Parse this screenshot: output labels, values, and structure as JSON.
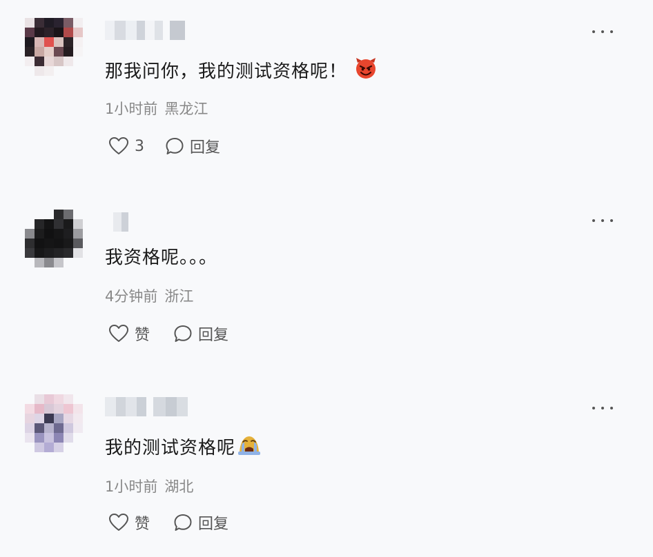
{
  "comments": [
    {
      "content": "那我问你，我的测试资格呢！",
      "emoji": "smiling-devil-emoji",
      "time": "1小时前",
      "location": "黑龙江",
      "like_label": "3",
      "reply_label": "回复"
    },
    {
      "content": "我资格呢。。。",
      "emoji": "",
      "time": "4分钟前",
      "location": "浙江",
      "like_label": "赞",
      "reply_label": "回复"
    },
    {
      "content": "我的测试资格呢",
      "emoji": "crying-face-emoji",
      "time": "1小时前",
      "location": "湖北",
      "like_label": "赞",
      "reply_label": "回复"
    }
  ],
  "colors": {
    "background": "#f8f9fb",
    "text": "#1a1a1a",
    "meta": "#888888",
    "action": "#555555",
    "devil_emoji": "#e8462e",
    "crying_emoji": "#8fb2e6"
  },
  "icons": {
    "like": "heart-outline-icon",
    "reply": "speech-bubble-icon",
    "more": "more-dots-icon"
  }
}
